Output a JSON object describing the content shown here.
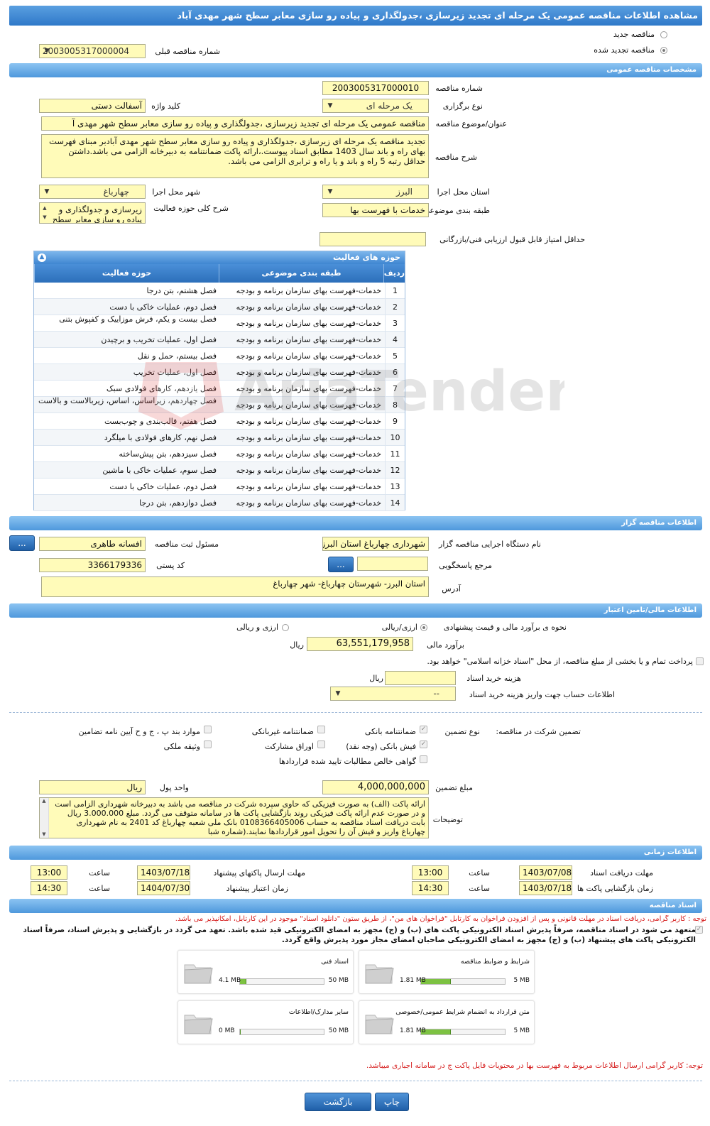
{
  "header": {
    "title": "مشاهده اطلاعات مناقصه عمومی یک مرحله ای تجدید زیرسازی ،جدولگذاری و پیاده رو سازی معابر سطح شهر مهدی آباد"
  },
  "top": {
    "radio_new": "مناقصه جدید",
    "radio_renewed": "مناقصه تجدید شده",
    "prev_number_label": "شماره مناقصه قبلی",
    "prev_number_value": "2003005317000004"
  },
  "general": {
    "section_title": "مشخصات مناقصه عمومی",
    "number_label": "شماره مناقصه",
    "number_value": "2003005317000010",
    "type_label": "نوع برگزاری",
    "type_value": "یک مرحله ای",
    "keyword_label": "کلید واژه",
    "keyword_value": "آسفالت دستی",
    "subject_label": "عنوان/موضوع مناقصه",
    "subject_value": "مناقصه عمومی یک مرحله ای تجدید زیرسازی ،جدولگذاری و پیاده رو سازی معابر سطح شهر مهدی آ",
    "desc_label": "شرح مناقصه",
    "desc_value": "تجدید مناقصه یک مرحله ای زیرسازی ،جدولگذاری و پیاده رو سازی معابر سطح شهر مهدی آبادبر مبنای فهرست بهای راه و باند سال 1403 مطابق اسناد پیوست.،ارائه پاکت ضمانتنامه به دبیرخانه الزامی می باشد.داشتن حداقل رتبه 5 راه و باند و یا راه و ترابری الزامی می باشد.",
    "province_label": "استان محل اجرا",
    "province_value": "البرز",
    "city_label": "شهر محل اجرا",
    "city_value": "چهارباغ",
    "category_label": "طبقه بندی موضوعی",
    "category_value": "خدمات با فهرست بها",
    "activity_desc_label": "شرح کلی حوزه فعالیت",
    "activity_desc_value": "زیرسازی و جدولگذاری و پیاده رو سازی معابر سطح",
    "min_score_label": "حداقل امتیاز قابل قبول ارزیابی فنی/بازرگانی",
    "min_score_value": ""
  },
  "activities": {
    "title": "حوزه های فعالیت",
    "col_row": "ردیف",
    "col_category": "طبقه بندی موضوعی",
    "col_area": "حوزه فعالیت",
    "rows": [
      {
        "n": "1",
        "cat": "خدمات-فهرست بهای سازمان برنامه و بودجه",
        "area": "فصل هشتم، بتن درجا"
      },
      {
        "n": "2",
        "cat": "خدمات-فهرست بهای سازمان برنامه و بودجه",
        "area": "فصل دوم، عملیات خاکی با دست"
      },
      {
        "n": "3",
        "cat": "خدمات-فهرست بهای سازمان برنامه و بودجه",
        "area": "فصل بیست و یکم، فرش موزاییک و کفپوش بتنی"
      },
      {
        "n": "4",
        "cat": "خدمات-فهرست بهای سازمان برنامه و بودجه",
        "area": "فصل اول، عملیات تخریب و برچیدن"
      },
      {
        "n": "5",
        "cat": "خدمات-فهرست بهای سازمان برنامه و بودجه",
        "area": "فصل بیستم، حمل و نقل"
      },
      {
        "n": "6",
        "cat": "خدمات-فهرست بهای سازمان برنامه و بودجه",
        "area": "فصل اول، عملیات تخریب"
      },
      {
        "n": "7",
        "cat": "خدمات-فهرست بهای سازمان برنامه و بودجه",
        "area": "فصل یازدهم، کارهای فولادی سبک"
      },
      {
        "n": "8",
        "cat": "خدمات-فهرست بهای سازمان برنامه و بودجه",
        "area": "فصل چهاردهم، زیراساس، اساس، زیربالاست و بالاست"
      },
      {
        "n": "9",
        "cat": "خدمات-فهرست بهای سازمان برنامه و بودجه",
        "area": "فصل هفتم، قالب‌بندی و چوب‌بست"
      },
      {
        "n": "10",
        "cat": "خدمات-فهرست بهای سازمان برنامه و بودجه",
        "area": "فصل نهم، کارهای فولادی با میلگرد"
      },
      {
        "n": "11",
        "cat": "خدمات-فهرست بهای سازمان برنامه و بودجه",
        "area": "فصل سیزدهم، بتن پیش‌ساخته"
      },
      {
        "n": "12",
        "cat": "خدمات-فهرست بهای سازمان برنامه و بودجه",
        "area": "فصل سوم، عملیات خاکی با ماشین"
      },
      {
        "n": "13",
        "cat": "خدمات-فهرست بهای سازمان برنامه و بودجه",
        "area": "فصل دوم، عملیات خاکی با دست"
      },
      {
        "n": "14",
        "cat": "خدمات-فهرست بهای سازمان برنامه و بودجه",
        "area": "فصل دوازدهم، بتن درجا"
      }
    ]
  },
  "organizer": {
    "section_title": "اطلاعات مناقصه گزار",
    "org_label": "نام دستگاه اجرایی مناقصه گزار",
    "org_value": "شهرداری چهارباغ استان البرز",
    "responsible_label": "مسئول ثبت مناقصه",
    "responsible_value": "افسانه طاهری",
    "reference_label": "مرجع پاسخگویی",
    "reference_value": "",
    "postal_label": "کد پستی",
    "postal_value": "3366179336",
    "address_label": "آدرس",
    "address_value": "استان البرز- شهرستان چهارباغ- شهر چهارباغ",
    "dots": "..."
  },
  "finance": {
    "section_title": "اطلاعات مالی/تامین اعتبار",
    "estimate_method_label": "نحوه ی برآورد مالی و قیمت پیشنهادی",
    "rial_option": "ارزی/ریالی",
    "fx_option": "ارزی و ریالی",
    "estimate_label": "برآورد مالی",
    "estimate_value": "63,551,179,958",
    "currency": "ریال",
    "treasury_text": "پرداخت تمام و یا بخشی از مبلغ مناقصه، از محل \"اسناد خزانه اسلامی\" خواهد بود.",
    "doc_cost_label": "هزینه خرید اسناد",
    "doc_cost_value": "",
    "account_label": "اطلاعات حساب جهت واریز هزینه خرید اسناد",
    "account_value": "--"
  },
  "guarantee": {
    "participation_label": "تضمین شرکت در مناقصه:",
    "type_label": "نوع تضمین",
    "bank_guarantee": "ضمانتنامه بانکی",
    "nonbank_guarantee": "ضمانتنامه غیربانکی",
    "clauses": "موارد بند پ ، ج و ح آیین نامه تضامین",
    "bank_receipt": "فیش بانکی (وجه نقد)",
    "participation_papers": "اوراق مشارکت",
    "property": "وثیقه ملکی",
    "claims_cert": "گواهی خالص مطالبات تایید شده قراردادها",
    "amount_label": "مبلغ تضمین",
    "amount_value": "4,000,000,000",
    "unit_label": "واحد پول",
    "unit_value": "ریال",
    "notes_label": "توضیحات",
    "notes_value": "ارائه پاکت (الف) به صورت فیزیکی که حاوی سپرده شرکت در مناقصه می باشد به دبیرخانه شهرداری الزامی است و در صورت عدم ارائه پاکت فیزیکی روند بازگشایی پاکت ها در سامانه متوقف می گردد. مبلغ 3.000.000 ریال بابت دریافت اسناد مناقصه به حساب 0108366405006 بانک ملی شعبه چهارباغ کد 2401 به نام شهرداری چهارباغ واریز و فیش آن را تحویل امور قراردادها نمایند.(شماره شبا"
  },
  "timing": {
    "section_title": "اطلاعات زمانی",
    "doc_deadline_label": "مهلت دریافت اسناد",
    "doc_deadline_date": "1403/07/08",
    "doc_deadline_time": "13:00",
    "submit_deadline_label": "مهلت ارسال پاکتهای پیشنهاد",
    "submit_deadline_date": "1403/07/18",
    "submit_deadline_time": "13:00",
    "opening_label": "زمان بازگشایی پاکت ها",
    "opening_date": "1403/07/18",
    "opening_time": "14:30",
    "validity_label": "زمان اعتبار پیشنهاد",
    "validity_date": "1404/07/30",
    "validity_time": "14:30",
    "time_label": "ساعت"
  },
  "docs": {
    "section_title": "اسناد مناقصه",
    "notice": "توجه : کاربر گرامی، دریافت اسناد در مهلت قانونی و پس از افزودن فراخوان به کارتابل \"فراخوان های من\"، از طریق ستون \"دانلود اسناد\" موجود در این کارتابل، امکانپذیر می باشد.",
    "commitment": "متعهد می شود در اسناد مناقصه، صرفاً پذیرش اسناد الکترونیکی پاکت های (ب) و (ج) مجهز به امضای الکترونیکی قید شده باشد. تعهد می گردد در بازگشایی و پذیرش اسناد، صرفاً اسناد الکترونیکی پاکت های پیشنهاد (ب) و (ج) مجهز به امضای الکترونیکی صاحبان امضای مجاز مورد پذیرش واقع گردد.",
    "files": [
      {
        "name": "شرایط و ضوابط مناقصه",
        "max": "5 MB",
        "used": "1.81 MB",
        "fill": 0.36
      },
      {
        "name": "اسناد فنی",
        "max": "50 MB",
        "used": "4.1 MB",
        "fill": 0.08
      },
      {
        "name": "متن قرارداد به انضمام شرایط عمومی/خصوصی",
        "max": "5 MB",
        "used": "1.81 MB",
        "fill": 0.36
      },
      {
        "name": "سایر مدارک/اطلاعات",
        "max": "50 MB",
        "used": "0 MB",
        "fill": 0.0
      }
    ],
    "footer_notice": "توجه: کاربر گرامی ارسال اطلاعات مربوط به فهرست بها در محتویات فایل پاکت ج در سامانه اجباری میباشد."
  },
  "actions": {
    "print": "چاپ",
    "back": "بازگشت"
  },
  "watermark_text": "AriaTender.neT"
}
